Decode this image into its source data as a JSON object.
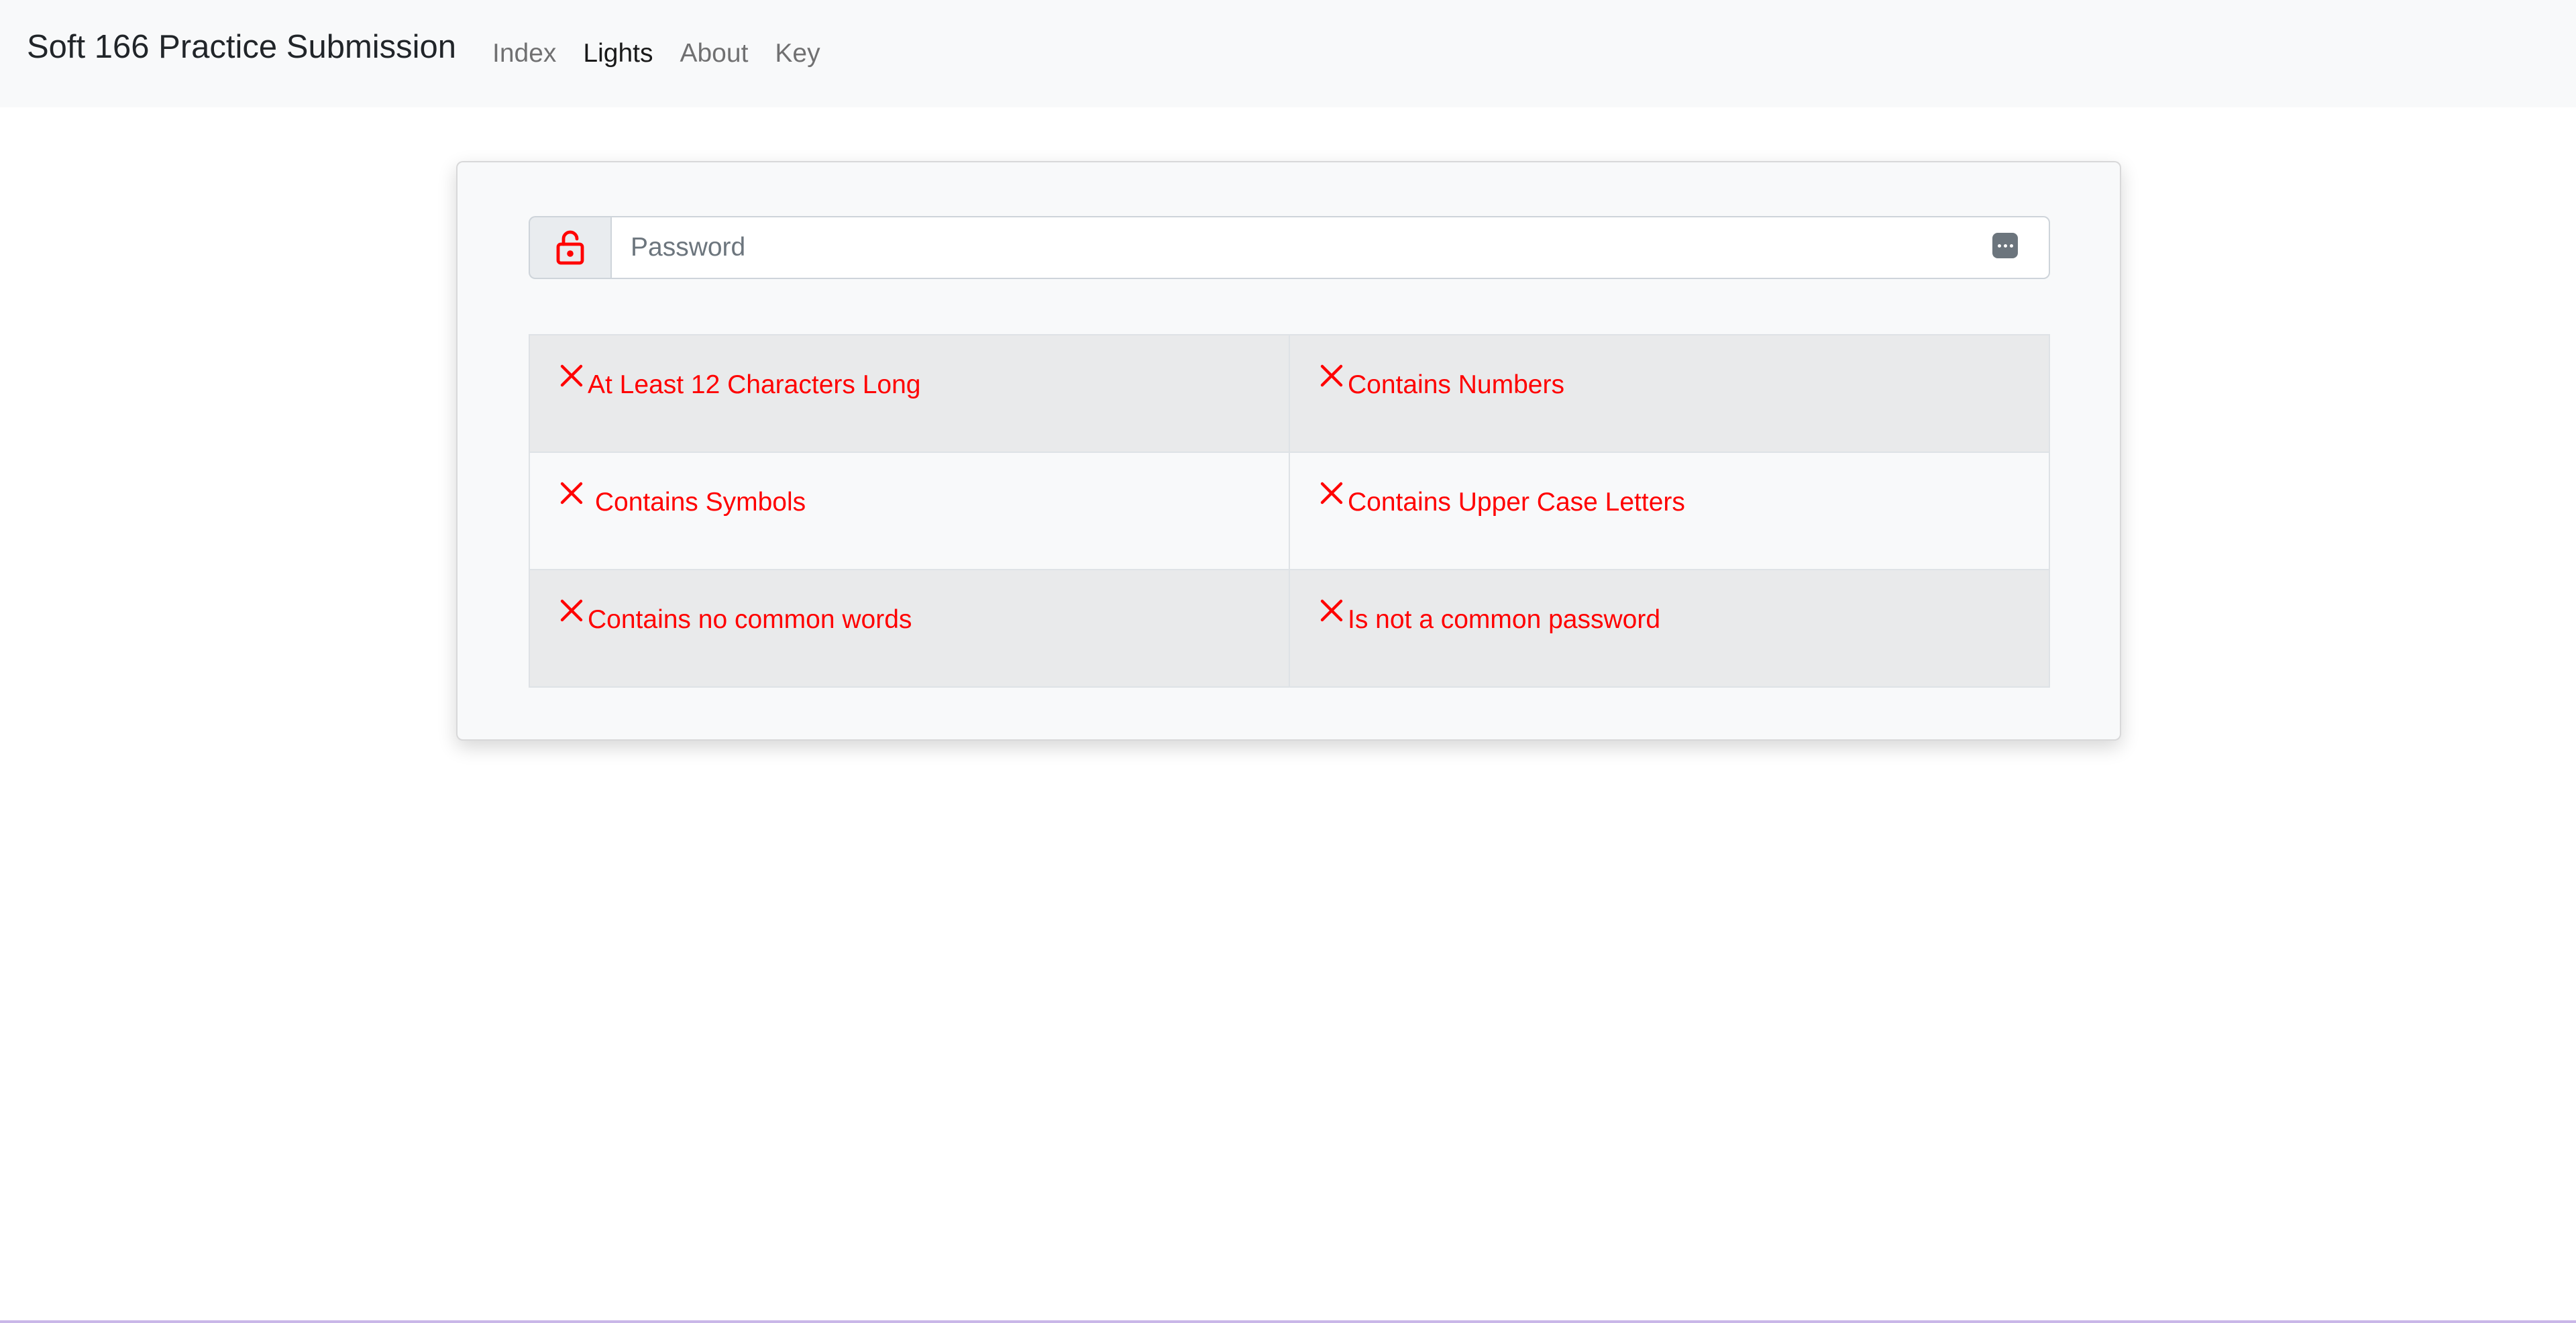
{
  "navbar": {
    "brand": "Soft 166 Practice Submission",
    "links": [
      {
        "label": "Index",
        "active": false
      },
      {
        "label": "Lights",
        "active": true
      },
      {
        "label": "About",
        "active": false
      },
      {
        "label": "Key",
        "active": false
      }
    ]
  },
  "password": {
    "placeholder": "Password",
    "value": "",
    "lock_icon": "unlock-icon",
    "reveal_icon": "password-reveal-icon"
  },
  "criteria": [
    {
      "label": "At Least 12 Characters Long",
      "met": false
    },
    {
      "label": "Contains Numbers",
      "met": false
    },
    {
      "label": "Contains Symbols",
      "met": false
    },
    {
      "label": "Contains Upper Case Letters",
      "met": false
    },
    {
      "label": "Contains no common words",
      "met": false
    },
    {
      "label": "Is not a common password",
      "met": false
    }
  ],
  "colors": {
    "fail": "#ff0000",
    "navbar_bg": "#f8f9fa"
  }
}
